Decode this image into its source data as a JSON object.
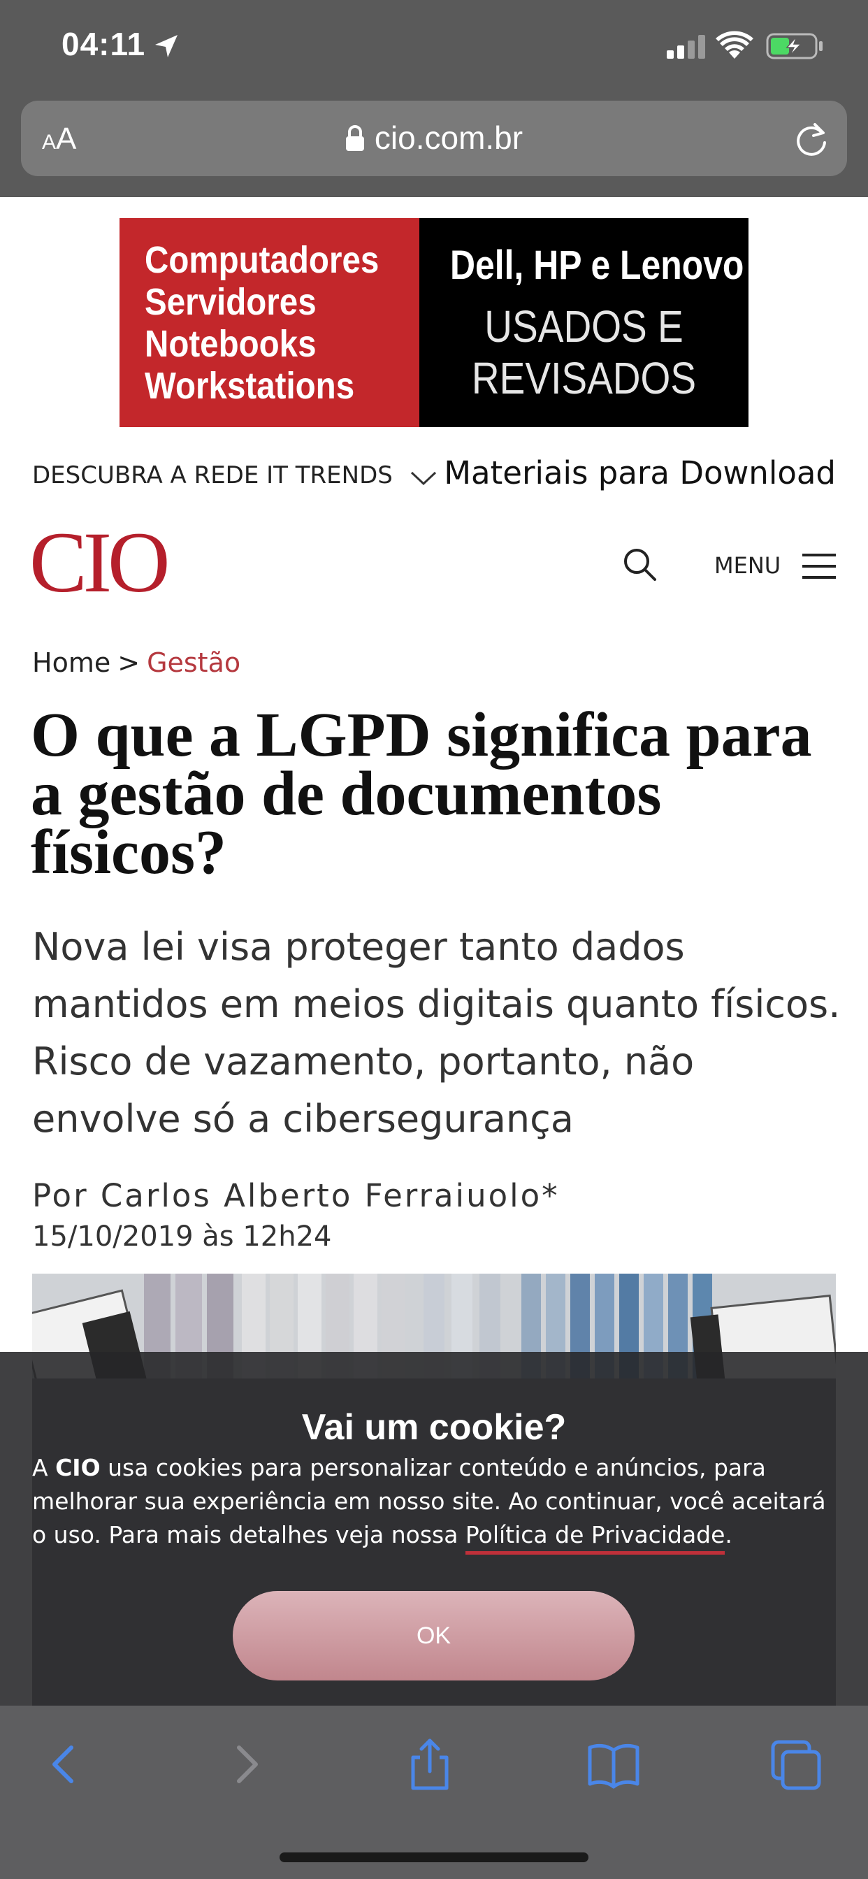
{
  "status_bar": {
    "time": "04:11"
  },
  "browser": {
    "text_size_small": "A",
    "text_size_large": "A",
    "url": "cio.com.br"
  },
  "ad": {
    "left_lines": [
      "Computadores",
      "Servidores",
      "Notebooks",
      "Workstations"
    ],
    "right_title": "Dell, HP e Lenovo",
    "right_sub_line1": "USADOS E",
    "right_sub_line2": "REVISADOS",
    "colors": {
      "left_bg": "#c3272b",
      "right_bg": "#000000"
    }
  },
  "network_bar": {
    "label": "DESCUBRA A REDE IT TRENDS",
    "downloads": "Materiais para Download"
  },
  "header": {
    "logo": "CIO",
    "menu_label": "MENU",
    "brand_color": "#b51f2b"
  },
  "breadcrumb": {
    "home": "Home",
    "separator": ">",
    "current": "Gestão"
  },
  "article": {
    "headline": "O que a LGPD significa para a gestão de documentos físicos?",
    "dek": "Nova lei visa proteger tanto dados mantidos em meios digitais quanto físicos. Risco de vazamento, portanto, não envolve só a cibersegurança",
    "byline": "Por Carlos Alberto Ferraiuolo*",
    "date": "15/10/2019 às 12h24"
  },
  "cookie_banner": {
    "title": "Vai um cookie?",
    "text_before": "A",
    "brand": "CIO",
    "text_after": "usa cookies para personalizar conteúdo e anúncios, para melhorar sua experiência em nosso site. Ao continuar, você aceitará o uso. Para mais detalhes veja nossa",
    "link": "Política de Privacidade",
    "period": ".",
    "ok_label": "OK"
  },
  "toolbar": {
    "icons": [
      "back-icon",
      "forward-icon",
      "share-icon",
      "bookmarks-icon",
      "tabs-icon"
    ],
    "accent": "#4a86e8"
  }
}
